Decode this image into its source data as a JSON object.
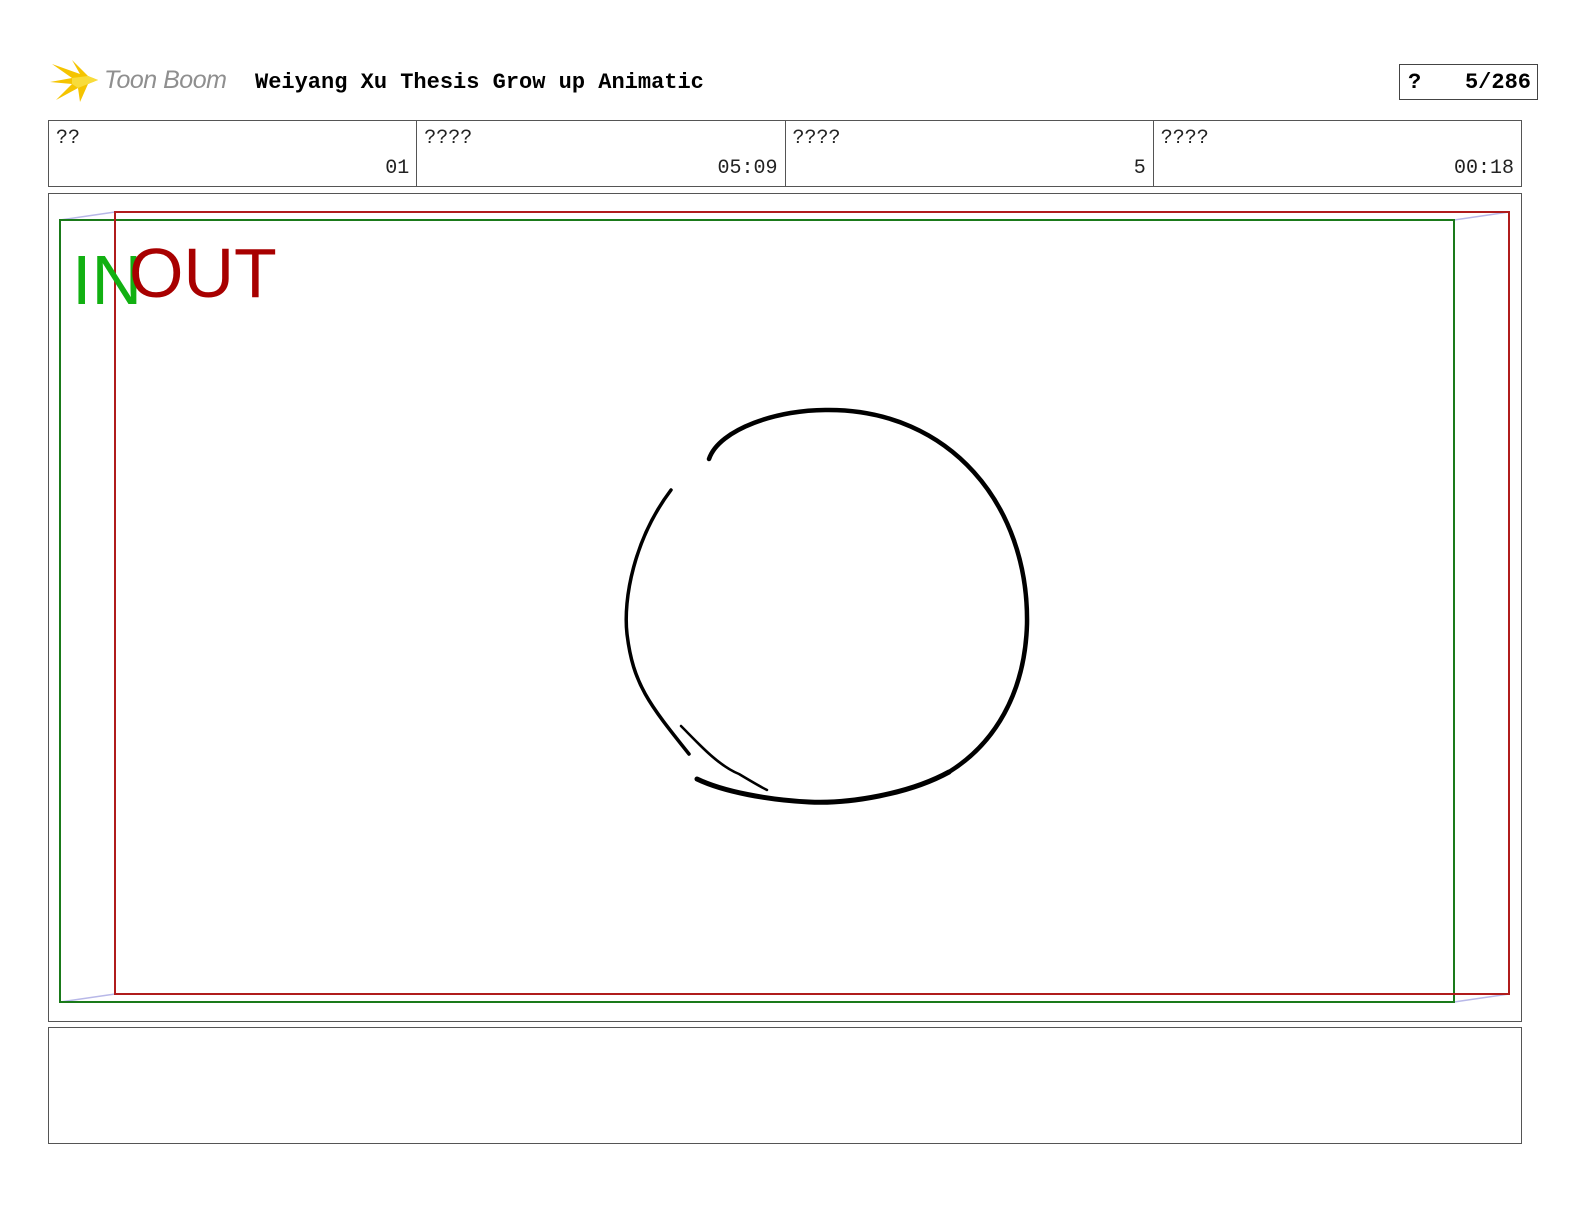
{
  "header": {
    "logo_text": "Toon Boom",
    "project_title": "Weiyang Xu Thesis Grow up Animatic",
    "page_prefix": "?",
    "page_indicator": "5/286"
  },
  "info_cells": [
    {
      "label": "??",
      "value": "01"
    },
    {
      "label": "????",
      "value": "05:09"
    },
    {
      "label": "????",
      "value": "5"
    },
    {
      "label": "????",
      "value": "00:18"
    }
  ],
  "panel": {
    "in_label": "IN",
    "out_label": "OUT",
    "colors": {
      "in_frame": "#1a7a1a",
      "in_text": "#12b012",
      "out_frame": "#b01c1c",
      "out_text": "#a80000",
      "guide_lines": "#b8b8e8",
      "drawing": "#000000"
    }
  },
  "notes": {
    "text": ""
  },
  "colors": {
    "logo_star": "#f5c400",
    "logo_text": "#8f8f8f"
  }
}
